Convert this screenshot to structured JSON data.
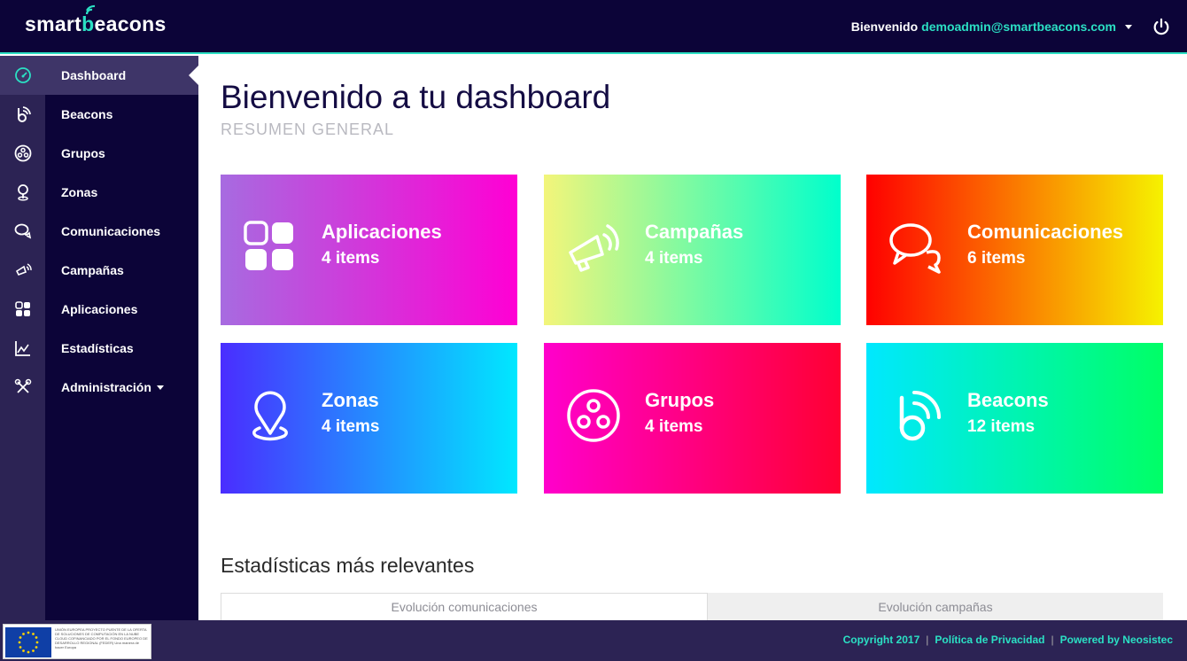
{
  "brand": {
    "logo_text_start": "smart",
    "logo_text_b": "b",
    "logo_text_end": "eacons"
  },
  "header": {
    "welcome_label": "Bienvenido",
    "user_email": "demoadmin@smartbeacons.com",
    "power_icon": "power-icon"
  },
  "sidebar": {
    "items": [
      {
        "label": "Dashboard",
        "icon": "dashboard-gauge-icon",
        "active": true
      },
      {
        "label": "Beacons",
        "icon": "beacon-icon"
      },
      {
        "label": "Grupos",
        "icon": "groups-icon"
      },
      {
        "label": "Zonas",
        "icon": "location-pin-icon"
      },
      {
        "label": "Comunicaciones",
        "icon": "chat-bubbles-icon"
      },
      {
        "label": "Campañas",
        "icon": "megaphone-icon"
      },
      {
        "label": "Aplicaciones",
        "icon": "apps-grid-icon"
      },
      {
        "label": "Estadísticas",
        "icon": "stats-chart-icon"
      },
      {
        "label": "Administración",
        "icon": "tools-icon",
        "has_dropdown": true
      }
    ]
  },
  "main": {
    "title": "Bienvenido a tu dashboard",
    "subtitle": "RESUMEN GENERAL",
    "cards": [
      {
        "name": "Aplicaciones",
        "count": "4 items",
        "icon": "apps-grid-icon",
        "gradient": [
          "#a76be0",
          "#ff00d4"
        ]
      },
      {
        "name": "Campañas",
        "count": "4 items",
        "icon": "megaphone-icon",
        "gradient": [
          "#f3f57a",
          "#00ffcc"
        ]
      },
      {
        "name": "Comunicaciones",
        "count": "6 items",
        "icon": "chat-bubbles-icon",
        "gradient": [
          "#ff0000",
          "#f6f200"
        ]
      },
      {
        "name": "Zonas",
        "count": "4 items",
        "icon": "location-pin-icon",
        "gradient": [
          "#4a2dff",
          "#00e8ff"
        ]
      },
      {
        "name": "Grupos",
        "count": "4 items",
        "icon": "groups-icon",
        "gradient": [
          "#ff00cc",
          "#ff0033"
        ]
      },
      {
        "name": "Beacons",
        "count": "12 items",
        "icon": "beacon-icon",
        "gradient": [
          "#00e8ff",
          "#00ff66"
        ]
      }
    ],
    "stats_title": "Estadísticas más relevantes",
    "tabs": [
      {
        "label": "Evolución comunicaciones",
        "active": true
      },
      {
        "label": "Evolución campañas",
        "active": false
      }
    ]
  },
  "footer": {
    "copyright": "Copyright 2017",
    "privacy": "Política de Privacidad",
    "powered": "Powered by Neosistec",
    "eu_text": "UNIÓN EUROPEA PROYECTO PUENTE DE LA OFERTA DE SOLUCIONES DE COMPUTACIÓN EN LA NUBE CLOUD COFINANCIADO POR EL FONDO EUROPEO DE DESARROLLO REGIONAL (FEDER) Una manera de hacer Europa"
  },
  "colors": {
    "topbar": "#0c0438",
    "accent": "#2be0c4",
    "rail": "#2c2354",
    "nav": "#0c0438"
  }
}
